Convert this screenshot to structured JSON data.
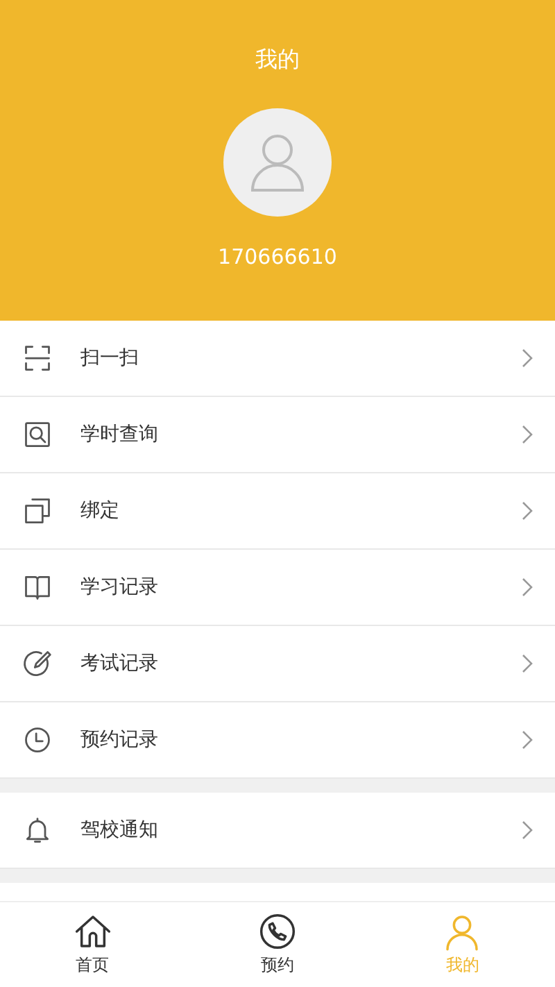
{
  "header": {
    "title": "我的",
    "phone": "170666610"
  },
  "menu_groups": [
    {
      "items": [
        {
          "label": "扫一扫"
        },
        {
          "label": "学时查询"
        },
        {
          "label": "绑定"
        },
        {
          "label": "学习记录"
        },
        {
          "label": "考试记录"
        },
        {
          "label": "预约记录"
        }
      ]
    },
    {
      "items": [
        {
          "label": "驾校通知"
        }
      ]
    }
  ],
  "tab_bar": [
    {
      "label": "首页",
      "selected": false
    },
    {
      "label": "预约",
      "selected": false
    },
    {
      "label": "我的",
      "selected": true
    }
  ]
}
